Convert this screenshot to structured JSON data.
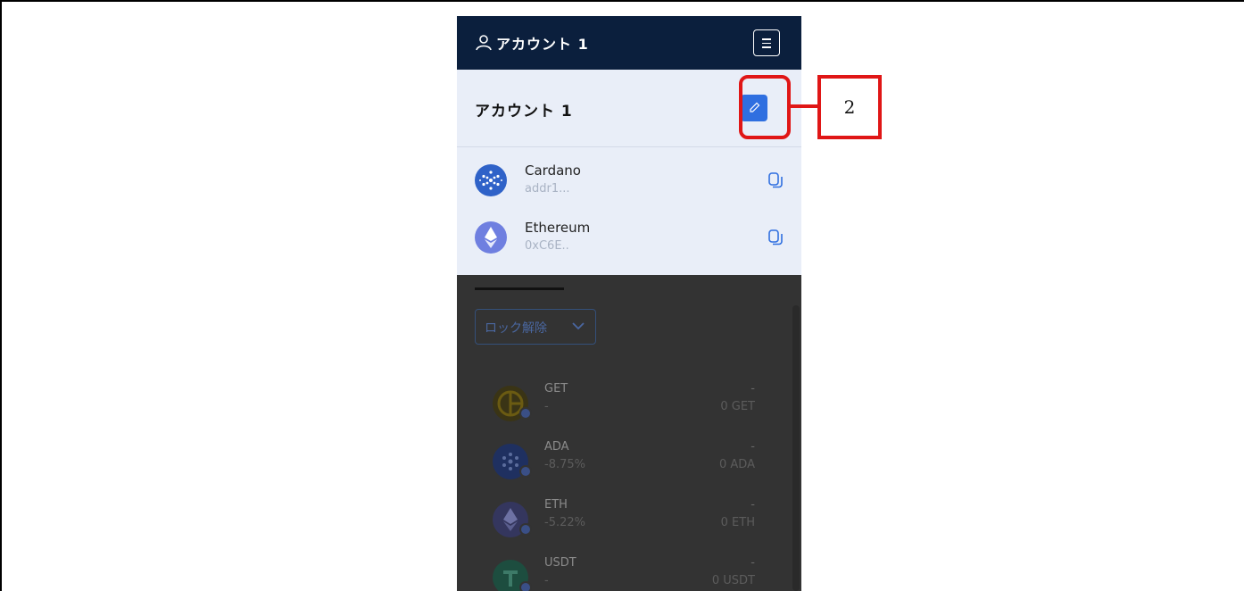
{
  "header": {
    "title": "アカウント 1"
  },
  "account": {
    "name": "アカウント 1"
  },
  "chains": [
    {
      "name": "Cardano",
      "address": "addr1..."
    },
    {
      "name": "Ethereum",
      "address": "0xC6E.."
    }
  ],
  "filter": {
    "selected": "ロック解除"
  },
  "tokens": [
    {
      "symbol": "GET",
      "change": "-",
      "fiat": "-",
      "balance": "0 GET"
    },
    {
      "symbol": "ADA",
      "change": "-8.75%",
      "fiat": "-",
      "balance": "0 ADA"
    },
    {
      "symbol": "ETH",
      "change": "-5.22%",
      "fiat": "-",
      "balance": "0 ETH"
    },
    {
      "symbol": "USDT",
      "change": "-",
      "fiat": "-",
      "balance": "0 USDT"
    }
  ],
  "annotation": {
    "label": "2"
  },
  "colors": {
    "header_bg": "#0b1f3d",
    "panel_bg": "#e9eef8",
    "edit_button": "#2f6fe0",
    "highlight": "#e01616"
  }
}
